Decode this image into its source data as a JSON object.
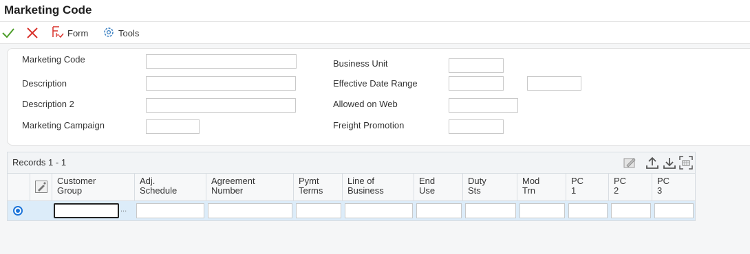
{
  "window": {
    "title": "Marketing Code"
  },
  "toolbar": {
    "ok_icon": "check-icon",
    "cancel_icon": "close-icon",
    "form_menu": {
      "label": "Form",
      "icon": "form-menu-icon"
    },
    "tools_menu": {
      "label": "Tools",
      "icon": "gear-icon"
    }
  },
  "form": {
    "marketing_code": {
      "label": "Marketing Code",
      "value": ""
    },
    "description": {
      "label": "Description",
      "value": ""
    },
    "description2": {
      "label": "Description 2",
      "value": ""
    },
    "marketing_campaign": {
      "label": "Marketing Campaign",
      "value": ""
    },
    "business_unit": {
      "label": "Business Unit",
      "value": ""
    },
    "effective_date_range": {
      "label": "Effective Date Range",
      "from": "",
      "to": ""
    },
    "allowed_on_web": {
      "label": "Allowed on Web",
      "value": ""
    },
    "freight_promotion": {
      "label": "Freight Promotion",
      "value": ""
    }
  },
  "grid": {
    "records_label": "Records",
    "records_range": "1 - 1",
    "columns": [
      {
        "line1": "Customer",
        "line2": "Group"
      },
      {
        "line1": "Adj.",
        "line2": "Schedule"
      },
      {
        "line1": "Agreement",
        "line2": "Number"
      },
      {
        "line1": "Pymt",
        "line2": "Terms"
      },
      {
        "line1": "Line of",
        "line2": "Business"
      },
      {
        "line1": "End",
        "line2": "Use"
      },
      {
        "line1": "Duty",
        "line2": "Sts"
      },
      {
        "line1": "Mod",
        "line2": "Trn"
      },
      {
        "line1": "PC",
        "line2": "1"
      },
      {
        "line1": "PC",
        "line2": "2"
      },
      {
        "line1": "PC",
        "line2": "3"
      }
    ],
    "row_ellipsis": "...",
    "accent_color": "#1a73d9"
  }
}
